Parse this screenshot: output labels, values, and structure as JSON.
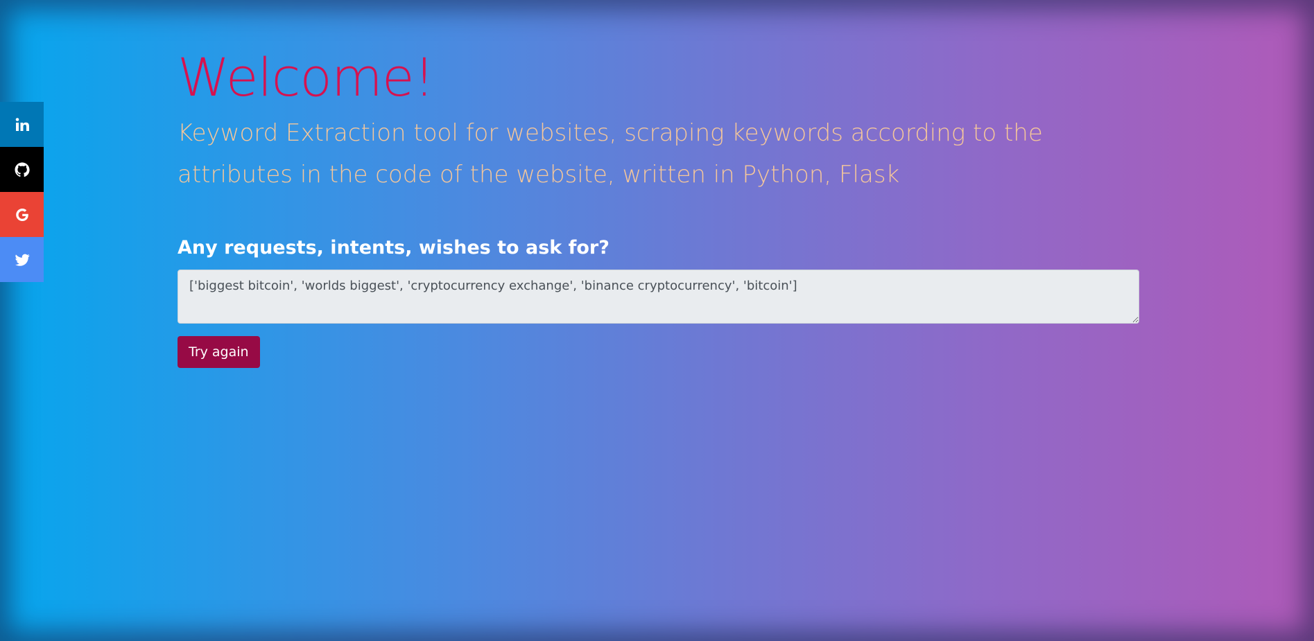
{
  "social": {
    "items": [
      {
        "name": "linkedin",
        "icon": "linkedin-icon",
        "color": "#0077b5"
      },
      {
        "name": "github",
        "icon": "github-icon",
        "color": "#000000"
      },
      {
        "name": "google",
        "icon": "google-icon",
        "color": "#ea4335"
      },
      {
        "name": "twitter",
        "icon": "twitter-icon",
        "color": "#4c8cf5"
      }
    ]
  },
  "main": {
    "title": "Welcome!",
    "subtitle": "Keyword Extraction tool for websites, scraping keywords according to the attributes in the code of the website, written in Python, Flask",
    "question": "Any requests, intents, wishes to ask for?",
    "result_value": "['biggest bitcoin', 'worlds biggest', 'cryptocurrency exchange', 'binance cryptocurrency', 'bitcoin']",
    "button_label": "Try again"
  },
  "colors": {
    "title": "#d6124f",
    "subtitle": "#f6c79a",
    "button": "#970a45",
    "gradient_start": "#06a6ed",
    "gradient_end": "#b05ab8"
  }
}
